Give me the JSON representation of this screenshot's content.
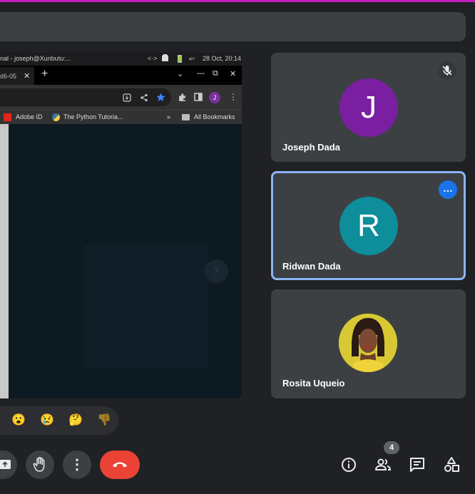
{
  "shared_screen": {
    "os_bar": {
      "title": "nal - joseph@Xunbutu:...",
      "code_glyph": "<·>",
      "volume_glyph": "◂×",
      "time": "28 Oct, 20:14"
    },
    "tab": {
      "label": "d6-05",
      "close": "✕",
      "new_tab": "+"
    },
    "window_controls": [
      "⌄",
      "—",
      "⧉",
      "✕"
    ],
    "bookmarks": {
      "adobe": "Adobe ID",
      "python": "The Python Tutoria...",
      "more": "»",
      "all": "All Bookmarks"
    },
    "profile_initial": "J",
    "next_glyph": "›"
  },
  "participants": [
    {
      "name": "Joseph Dada",
      "initial": "J",
      "color": "#7b1fa2",
      "muted": true
    },
    {
      "name": "Ridwan Dada",
      "initial": "R",
      "color": "#0d8e9a",
      "active": true
    },
    {
      "name": "Rosita Uqueio",
      "photo": true
    }
  ],
  "reactions": [
    "😮",
    "😢",
    "🤔",
    "👎"
  ],
  "controls": {
    "more_glyph": "⋮",
    "participant_count": "4"
  }
}
